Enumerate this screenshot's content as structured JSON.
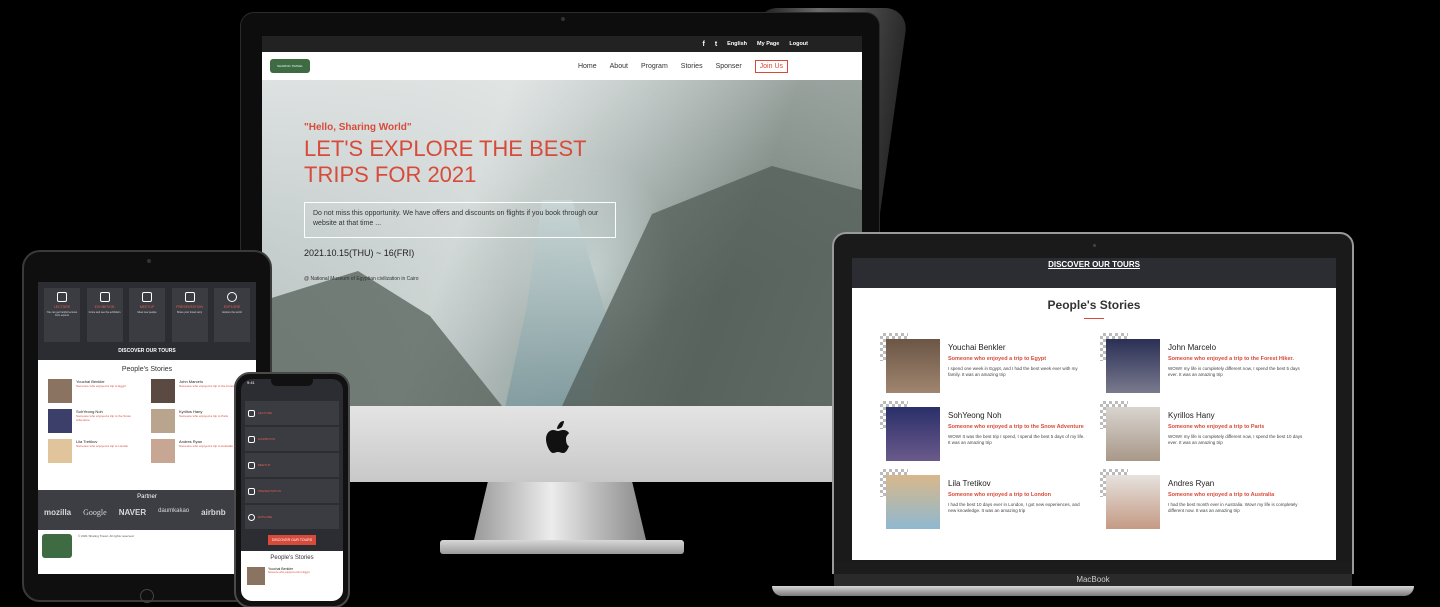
{
  "imac": {
    "topbar": {
      "facebook": "f",
      "twitter": "t",
      "language": "English",
      "mypage": "My Page",
      "logout": "Logout"
    },
    "nav": {
      "logo": "SHARING TRAVEL",
      "items": [
        "Home",
        "About",
        "Program",
        "Stories",
        "Sponser"
      ],
      "join": "Join Us"
    },
    "hero": {
      "subtitle": "\"Hello, Sharing World\"",
      "title": "LET'S EXPLORE THE BEST TRIPS FOR 2021",
      "description": "Do not miss this opportunity. We have offers and discounts on flights if you book through our website at that time ...",
      "date": "2021.10.15(THU) ~ 16(FRI)",
      "place": "@ National Museum of Egyptian civilization in Cairo"
    }
  },
  "tablet": {
    "categories": [
      {
        "label": "LECTURE",
        "text": "You can get helpful lectures from experts"
      },
      {
        "label": "EXHIBITION",
        "text": "Come and see the exhibition"
      },
      {
        "label": "MEETUP",
        "text": "Meet new people"
      },
      {
        "label": "PRESENTATION",
        "text": "Share your travel story"
      },
      {
        "label": "EXPLORE",
        "text": "Explore the world"
      }
    ],
    "discover": "DISCOVER OUR TOURS",
    "stories_title": "People's Stories",
    "stories": [
      {
        "name": "Youchai Benkler",
        "red": "Someone who enjoyed a trip to Egypt"
      },
      {
        "name": "John Marcelo",
        "red": "Someone who enjoyed a trip to the Forest Hiker"
      },
      {
        "name": "SohYeong Noh",
        "red": "Someone who enjoyed a trip to the Snow Adventure"
      },
      {
        "name": "Kyrillos Hany",
        "red": "Someone who enjoyed a trip to Paris"
      },
      {
        "name": "Lila Tretikov",
        "red": "Someone who enjoyed a trip to London"
      },
      {
        "name": "Andres Ryan",
        "red": "Someone who enjoyed a trip to Australia"
      }
    ],
    "partner_title": "Partner",
    "partners": [
      "mozilla",
      "Google",
      "NAVER",
      "daumkakao",
      "airbnb"
    ],
    "footer": "© 2021 Sharing Travel. All rights reserved."
  },
  "phone": {
    "time": "9:41",
    "rows": [
      "LECTURE",
      "EXHIBITION",
      "MEETUP",
      "PRESENTATION",
      "EXPLORE"
    ],
    "button": "DISCOVER OUR TOURS",
    "stories_title": "People's Stories",
    "story_name": "Youchai Benkler",
    "story_red": "Someone who enjoyed a trip to Egypt"
  },
  "macbook": {
    "discover": "DISCOVER OUR TOURS",
    "stories_title": "People's Stories",
    "brand": "MacBook",
    "stories": [
      {
        "name": "Youchai Benkler",
        "red": "Someone who enjoyed a trip to Egypt",
        "text": "I spend one week in Egypt, and I had the best week ever with my family. It was an amazing trip"
      },
      {
        "name": "John Marcelo",
        "red": "Someone who enjoyed a trip to the Forest Hiker.",
        "text": "WOW!! my life is completely different now, I spend the best 5 days ever. It was an amazing trip"
      },
      {
        "name": "SohYeong Noh",
        "red": "Someone who enjoyed a trip to the Snow Adventure",
        "text": "WOW! It was the best trip I spend, I spend the best 5 days of my life. It was an amazing trip"
      },
      {
        "name": "Kyrillos Hany",
        "red": "Someone who enjoyed a trip to Paris",
        "text": "WOW!! my life is completely different now, I spend the best 10 days ever. It was an amazing trip"
      },
      {
        "name": "Lila Tretikov",
        "red": "Someone who enjoyed a trip to London",
        "text": "I had the best 10 days ever in London, I got new experiences, and new knowledge. It was an amazing trip"
      },
      {
        "name": "Andres Ryan",
        "red": "Someone who enjoyed a trip to Australia",
        "text": "I had the best month ever in Australia. Wow! my life is completely different now. It was an amazing trip"
      }
    ]
  },
  "colors": {
    "accent": "#d84b3a",
    "dark": "#2b2d33",
    "brand_green": "#3f6b42"
  }
}
